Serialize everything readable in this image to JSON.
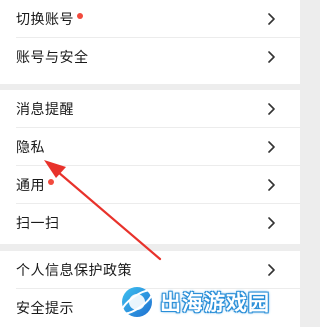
{
  "settings": {
    "groups": [
      {
        "items": [
          {
            "label": "切换账号",
            "has_dot": true
          },
          {
            "label": "账号与安全",
            "has_dot": false
          }
        ]
      },
      {
        "items": [
          {
            "label": "消息提醒",
            "has_dot": false
          },
          {
            "label": "隐私",
            "has_dot": false
          },
          {
            "label": "通用",
            "has_dot": true
          },
          {
            "label": "扫一扫",
            "has_dot": false
          }
        ]
      },
      {
        "items": [
          {
            "label": "个人信息保护政策",
            "has_dot": false
          },
          {
            "label": "安全提示",
            "has_dot": false
          }
        ]
      }
    ]
  },
  "annotation": {
    "arrow_color": "#e8322b",
    "points_to": "隐私"
  },
  "watermark": {
    "text": "出海游戏园",
    "logo_icon": "planet-logo-icon"
  },
  "colors": {
    "background": "#ededed",
    "row": "#ffffff",
    "text": "#1a1a1a",
    "dot": "#f24a3d",
    "chevron": "#333333"
  }
}
